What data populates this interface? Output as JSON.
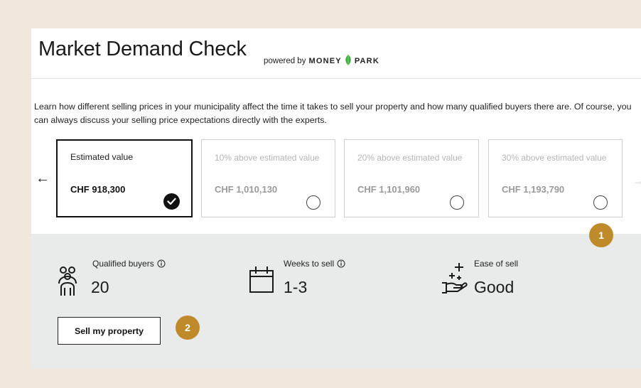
{
  "header": {
    "title": "Market Demand Check",
    "powered_by": "powered by",
    "brand_left": "MONEY",
    "brand_right": "PARK"
  },
  "intro": "Learn how different selling prices in your municipality affect the time it takes to sell your property and how many qualified buyers there are. Of course, you can always discuss your selling price expectations directly with the experts.",
  "carousel": {
    "prev_arrow": "←",
    "next_arrow": "→",
    "cards": [
      {
        "label": "Estimated value",
        "value": "CHF 918,300",
        "selected": true
      },
      {
        "label": "10% above estimated value",
        "value": "CHF 1,010,130",
        "selected": false
      },
      {
        "label": "20% above estimated value",
        "value": "CHF 1,101,960",
        "selected": false
      },
      {
        "label": "30% above estimated value",
        "value": "CHF 1,193,790",
        "selected": false
      }
    ]
  },
  "metrics": {
    "buyers": {
      "label": "Qualified buyers",
      "value": "20",
      "icon": "people-icon"
    },
    "weeks": {
      "label": "Weeks to sell",
      "value": "1-3",
      "icon": "calendar-icon"
    },
    "ease": {
      "label": "Ease of sell",
      "value": "Good",
      "icon": "hand-sparkle-icon"
    }
  },
  "actions": {
    "sell_label": "Sell my property"
  },
  "badges": {
    "one": "1",
    "two": "2"
  },
  "colors": {
    "background": "#f1e8dd",
    "panel": "#ffffff",
    "metrics_bg": "#e9ebeb",
    "badge": "#bf8a2a",
    "brand_green": "#4caf50"
  }
}
